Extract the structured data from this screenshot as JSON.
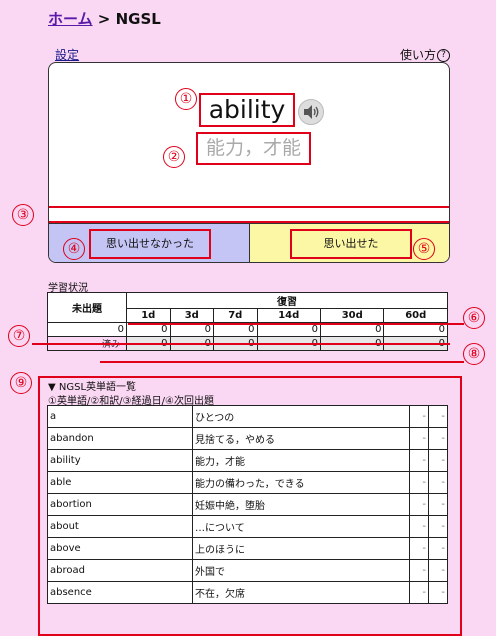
{
  "breadcrumb": {
    "home": "ホーム",
    "separator": " > ",
    "current": "NGSL"
  },
  "links": {
    "settings": "設定",
    "howto": "使い方",
    "howto_icon": "?"
  },
  "card": {
    "word": "ability",
    "meaning": "能力，才能",
    "speaker_icon": "speaker-icon",
    "btn_fail": "思い出せなかった",
    "btn_ok": "思い出せた"
  },
  "markers": [
    "①",
    "②",
    "③",
    "④",
    "⑤",
    "⑥",
    "⑦",
    "⑧",
    "⑨"
  ],
  "status": {
    "title": "学習状況",
    "not_yet": "未出題",
    "review": "復習",
    "intervals": [
      "1d",
      "3d",
      "7d",
      "14d",
      "30d",
      "60d"
    ],
    "unasked_count": "0",
    "counts": [
      "0",
      "0",
      "0",
      "0",
      "0",
      "0"
    ],
    "done_label": "済み",
    "done_counts": [
      "0",
      "0",
      "0",
      "0",
      "0",
      "0"
    ]
  },
  "list": {
    "title": "▼ NGSL英単語一覧",
    "legend": "①英単語/②和訳/③経過日/④次回出題",
    "rows": [
      {
        "en": "a",
        "ja": "ひとつの",
        "d1": "-",
        "d2": "-"
      },
      {
        "en": "abandon",
        "ja": "見捨てる，やめる",
        "d1": "-",
        "d2": "-"
      },
      {
        "en": "ability",
        "ja": "能力，才能",
        "d1": "-",
        "d2": "-"
      },
      {
        "en": "able",
        "ja": "能力の備わった，できる",
        "d1": "-",
        "d2": "-"
      },
      {
        "en": "abortion",
        "ja": "妊娠中絶，堕胎",
        "d1": "-",
        "d2": "-"
      },
      {
        "en": "about",
        "ja": "…について",
        "d1": "-",
        "d2": "-"
      },
      {
        "en": "above",
        "ja": "上のほうに",
        "d1": "-",
        "d2": "-"
      },
      {
        "en": "abroad",
        "ja": "外国で",
        "d1": "-",
        "d2": "-"
      },
      {
        "en": "absence",
        "ja": "不在，欠席",
        "d1": "-",
        "d2": "-"
      }
    ]
  },
  "colors": {
    "accent_red": "#e0001a",
    "page_bg": "#fad7f3",
    "fail_bg": "#c4c4f5",
    "ok_bg": "#fbf7a5"
  }
}
